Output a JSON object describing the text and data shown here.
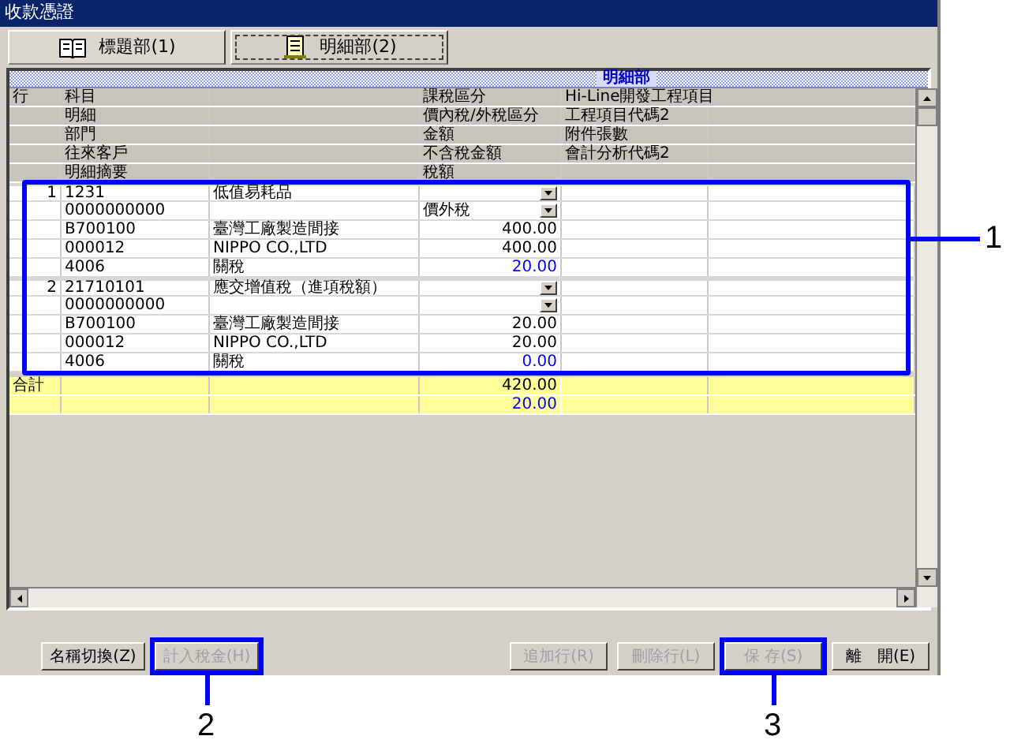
{
  "window": {
    "title": "收款憑證"
  },
  "tabs": [
    {
      "label": "標題部(1)",
      "selected": false
    },
    {
      "label": "明細部(2)",
      "selected": true
    }
  ],
  "grid": {
    "section_title": "明細部",
    "header_rows": [
      {
        "line_no": "行",
        "c1": "科目",
        "c3": "課稅區分",
        "c4": "Hi-Line開發工程項目"
      },
      {
        "c1": "明細",
        "c3": "價內稅/外稅區分",
        "c4": "工程項目代碼2"
      },
      {
        "c1": "部門",
        "c3": "金額",
        "c4": "附件張數"
      },
      {
        "c1": "往來客戶",
        "c3": "不含稅金額",
        "c4": "會計分析代碼2"
      },
      {
        "c1": "明細摘要",
        "c3": "稅額"
      }
    ],
    "entries": [
      {
        "line_no": "1",
        "rows": [
          {
            "kind": "select",
            "c1": "1231",
            "c2": "低值易耗品"
          },
          {
            "kind": "select",
            "c1": "0000000000",
            "c3": "價外稅"
          },
          {
            "kind": "amount",
            "c1": "B700100",
            "c2": "臺灣工廠製造間接",
            "c3": "400.00"
          },
          {
            "kind": "amount",
            "c1": "000012",
            "c2": "NIPPO CO.,LTD",
            "c3": "400.00"
          },
          {
            "kind": "tax_amount",
            "c1": "4006",
            "c2": "關稅",
            "c3": "20.00"
          }
        ]
      },
      {
        "line_no": "2",
        "rows": [
          {
            "kind": "select",
            "c1": "21710101",
            "c2": "應交增值稅（進項稅額）"
          },
          {
            "kind": "select",
            "c1": "0000000000"
          },
          {
            "kind": "amount",
            "c1": "B700100",
            "c2": "臺灣工廠製造間接",
            "c3": "20.00"
          },
          {
            "kind": "amount",
            "c1": "000012",
            "c2": "NIPPO CO.,LTD",
            "c3": "20.00"
          },
          {
            "kind": "tax_amount",
            "c1": "4006",
            "c2": "關稅",
            "c3": "0.00"
          }
        ]
      }
    ],
    "totals": {
      "label": "合計",
      "rows": [
        {
          "kind": "amount",
          "c3": "420.00"
        },
        {
          "kind": "tax_amount",
          "c3": "20.00"
        }
      ]
    },
    "callout": "1"
  },
  "buttons": [
    {
      "label": "名稱切換(Z)",
      "disabled": false
    },
    {
      "label": "計入稅金(H)",
      "disabled": true,
      "callout": "2"
    },
    {
      "label": "追加行(R)",
      "disabled": true
    },
    {
      "label": "刪除行(L)",
      "disabled": true
    },
    {
      "label": "保 存(S)",
      "disabled": true,
      "callout": "3"
    },
    {
      "label": "離　開(E)",
      "disabled": false
    }
  ]
}
